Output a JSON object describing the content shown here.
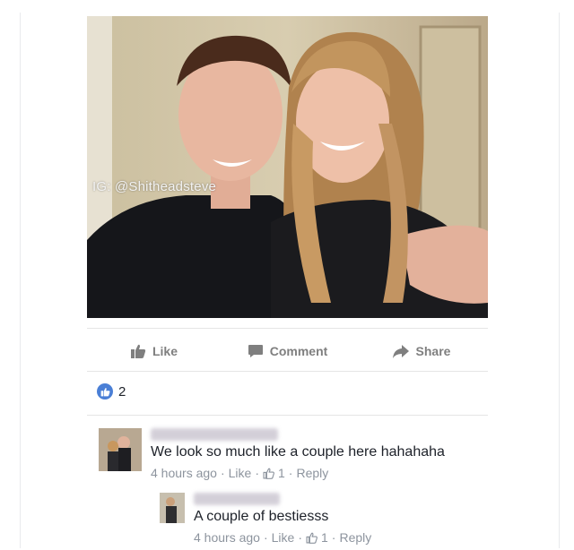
{
  "photo": {
    "watermark": "IG: @Shitheadsteve"
  },
  "actions": {
    "like": "Like",
    "comment": "Comment",
    "share": "Share"
  },
  "reactions": {
    "count": "2"
  },
  "comments": [
    {
      "text": "We look so much like a couple here hahahaha",
      "time": "4 hours ago",
      "like": "Like",
      "likes": "1",
      "reply": "Reply"
    },
    {
      "text": "A couple of bestiesss",
      "time": "4 hours ago",
      "like": "Like",
      "likes": "1",
      "reply": "Reply"
    }
  ],
  "colors": {
    "accent": "#4a7fd6",
    "muted": "#8d949e",
    "action": "#7f7f7f"
  }
}
